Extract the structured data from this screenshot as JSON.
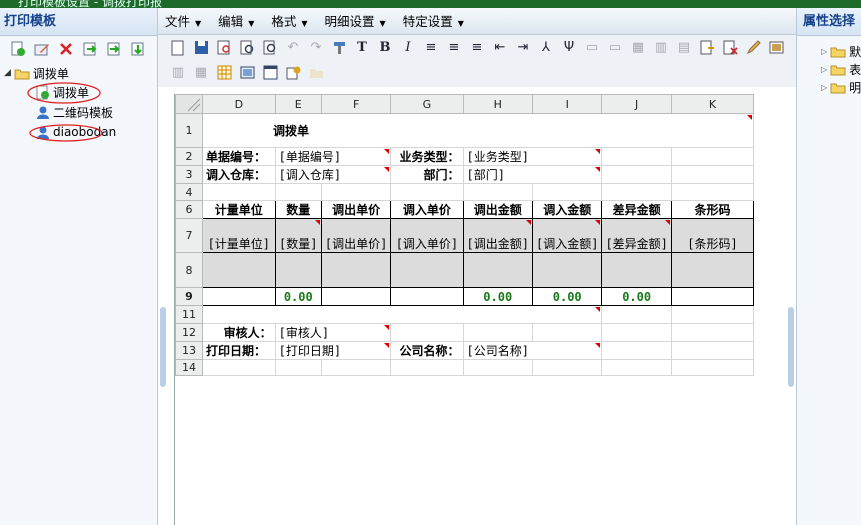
{
  "window": {
    "title": "打印模板设置 - 调拨打印报"
  },
  "left_panel": {
    "title": "打印模板",
    "tree": {
      "root": "调拨单",
      "children": [
        "调拨单",
        "二维码模板",
        "diaobodan"
      ]
    }
  },
  "right_panel": {
    "title": "属性选择",
    "items": [
      "默",
      "表",
      "明"
    ]
  },
  "menu": [
    "文件",
    "编辑",
    "格式",
    "明细设置",
    "特定设置"
  ],
  "sheet": {
    "columns": [
      "D",
      "E",
      "F",
      "G",
      "H",
      "I",
      "J",
      "K"
    ],
    "row_numbers": [
      "1",
      "2",
      "3",
      "4",
      "6",
      "7",
      "8",
      "9",
      "11",
      "12",
      "13",
      "14"
    ],
    "title": "调拨单",
    "r2": {
      "l1": "单据编号：",
      "v1": "[单据编号]",
      "l2": "业务类型：",
      "v2": "[业务类型]"
    },
    "r3": {
      "l1": "调入仓库：",
      "v1": "[调入仓库]",
      "l2": "部门：",
      "v2": "[部门]"
    },
    "headers": [
      "计量单位",
      "数量",
      "调出单价",
      "调入单价",
      "调出金额",
      "调入金额",
      "差异金额",
      "条形码"
    ],
    "fields": [
      "[计量单位]",
      "[数量]",
      "[调出单价]",
      "[调入单价]",
      "[调出金额]",
      "[调入金额]",
      "[差异金额]",
      "[条形码]"
    ],
    "totals": {
      "qty": "0.00",
      "out_amt": "0.00",
      "in_amt": "0.00",
      "diff_amt": "0.00"
    },
    "r12": {
      "l1": "审核人：",
      "v1": "[审核人]"
    },
    "r13": {
      "l1": "打印日期：",
      "v1": "[打印日期]",
      "l2": "公司名称：",
      "v2": "[公司名称]"
    }
  }
}
